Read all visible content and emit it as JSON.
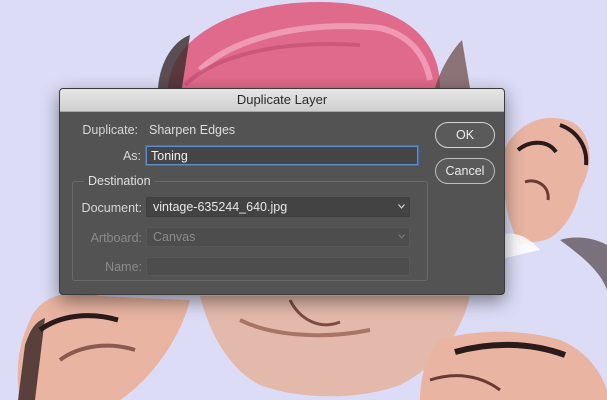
{
  "dialog": {
    "title": "Duplicate Layer",
    "duplicate_label": "Duplicate:",
    "duplicate_value": "Sharpen Edges",
    "as_label": "As:",
    "as_value": "Toning",
    "destination_title": "Destination",
    "document_label": "Document:",
    "document_value": "vintage-635244_640.jpg",
    "artboard_label": "Artboard:",
    "artboard_value": "Canvas",
    "name_label": "Name:",
    "name_value": "",
    "ok_label": "OK",
    "cancel_label": "Cancel"
  },
  "colors": {
    "canvas_background": "#dcdcf7",
    "dialog_background": "#535353",
    "focus_ring": "#5f8fcd",
    "hat_pink": "#e06a8c",
    "skin": "#e9b4a2"
  }
}
